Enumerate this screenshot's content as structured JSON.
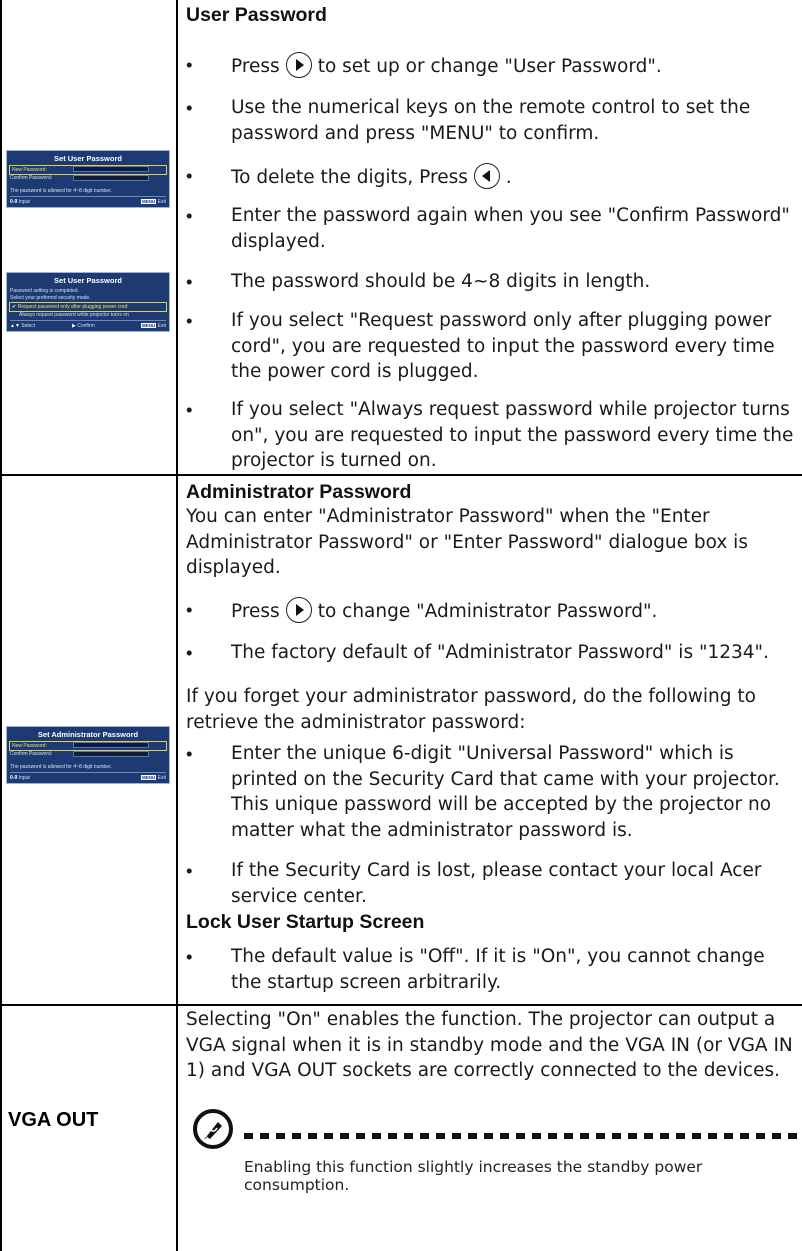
{
  "sections": {
    "user_password": {
      "title": "User Password",
      "bullets": {
        "b1_pre": "Press",
        "b1_post": "to set up or change \"User Password\".",
        "b2": "Use the numerical keys on the remote control to set the password and press \"MENU\" to confirm.",
        "b3": "To delete the digits, Press",
        "b3_end": ".",
        "b4": "Enter the password again when you see \"Confirm Password\" displayed.",
        "b5": "The password should be 4~8 digits in length.",
        "b6": "If you select \"Request password only after plugging power cord\", you are requested to input the password every time the power cord is plugged.",
        "b7": "If you select \"Always request password while projector turns on\", you are requested to input the password every time the projector is turned on."
      }
    },
    "admin_password": {
      "title": "Administrator Password",
      "intro": "You can enter \"Administrator Password\" when the \"Enter Administrator Password\" or \"Enter Password\" dialogue box is displayed.",
      "b1_pre": "Press",
      "b1_post": "to change \"Administrator Password\".",
      "b2": "The factory default of \"Administrator Password\" is \"1234\".",
      "forget": "If you forget your administrator password, do the following to retrieve the administrator password:",
      "b3": "Enter the unique 6-digit \"Universal Password\" which is printed on the Security Card that came with your projector. This unique password will be accepted by the projector no matter what the administrator password is.",
      "b4": "If the Security Card is lost, please contact your local Acer service center."
    },
    "lock_startup": {
      "title": "Lock User Startup Screen",
      "b1": "The default value is \"Off\". If it is \"On\", you cannot change the startup screen arbitrarily."
    },
    "vga_out": {
      "label": "VGA OUT",
      "text": "Selecting \"On\" enables the function. The projector can output a VGA signal when it is in standby mode and the VGA IN (or VGA IN 1) and VGA OUT sockets are correctly connected to the devices.",
      "note": "Enabling this function slightly increases the standby power consumption."
    }
  },
  "osd": {
    "set_user": {
      "title": "Set User Password",
      "new": "New Password:",
      "confirm": "Confirm Password:",
      "hint": "The password is allowed for 4~8 digit number.",
      "foot_left": "Input",
      "foot_right": "Exit",
      "menu": "MENU"
    },
    "set_user_mode": {
      "title": "Set User Password",
      "l1": "Password setting is completed.",
      "l2": "Select your preferred security mode.",
      "opt1": "Request password only after plugging power cord",
      "opt2": "Always request password while projector turns on",
      "foot_select": "Select",
      "foot_confirm": "Confirm",
      "foot_exit": "Exit",
      "menu": "MENU"
    },
    "set_admin": {
      "title": "Set Administrator Password",
      "new": "New Password:",
      "confirm": "Confirm Password:",
      "hint": "The password is allowed for 4~8 digit number.",
      "foot_left": "Input",
      "foot_right": "Exit",
      "menu": "MENU"
    }
  },
  "bullet_char": "•"
}
